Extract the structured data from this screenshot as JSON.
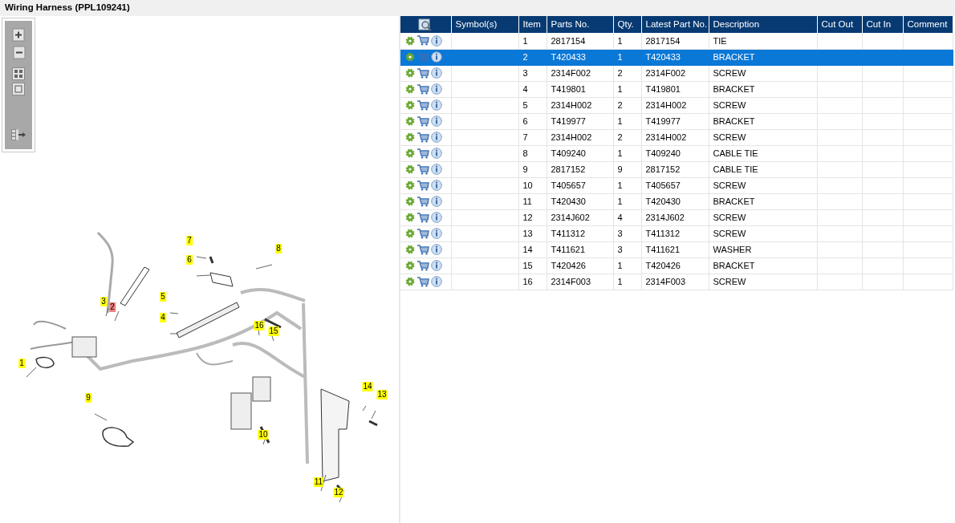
{
  "window": {
    "title": "Wiring Harness (PPL109241)"
  },
  "diagram": {
    "callouts": [
      {
        "label": "1",
        "selected": false
      },
      {
        "label": "2",
        "selected": true
      },
      {
        "label": "3",
        "selected": false
      },
      {
        "label": "4",
        "selected": false
      },
      {
        "label": "5",
        "selected": false
      },
      {
        "label": "6",
        "selected": false
      },
      {
        "label": "7",
        "selected": false
      },
      {
        "label": "8",
        "selected": false
      },
      {
        "label": "9",
        "selected": false
      },
      {
        "label": "10",
        "selected": false
      },
      {
        "label": "11",
        "selected": false
      },
      {
        "label": "12",
        "selected": false
      },
      {
        "label": "13",
        "selected": false
      },
      {
        "label": "14",
        "selected": false
      },
      {
        "label": "15",
        "selected": false
      },
      {
        "label": "16",
        "selected": false
      }
    ]
  },
  "table": {
    "columns": [
      "Symbol(s)",
      "Item",
      "Parts No.",
      "Qty.",
      "Latest Part No.",
      "Description",
      "Cut Out",
      "Cut In",
      "Comment"
    ],
    "rows": [
      {
        "item": "1",
        "parts_no": "2817154",
        "qty": "1",
        "latest_part_no": "2817154",
        "description": "TIE",
        "selected": false
      },
      {
        "item": "2",
        "parts_no": "T420433",
        "qty": "1",
        "latest_part_no": "T420433",
        "description": "BRACKET",
        "selected": true
      },
      {
        "item": "3",
        "parts_no": "2314F002",
        "qty": "2",
        "latest_part_no": "2314F002",
        "description": "SCREW",
        "selected": false
      },
      {
        "item": "4",
        "parts_no": "T419801",
        "qty": "1",
        "latest_part_no": "T419801",
        "description": "BRACKET",
        "selected": false
      },
      {
        "item": "5",
        "parts_no": "2314H002",
        "qty": "2",
        "latest_part_no": "2314H002",
        "description": "SCREW",
        "selected": false
      },
      {
        "item": "6",
        "parts_no": "T419977",
        "qty": "1",
        "latest_part_no": "T419977",
        "description": "BRACKET",
        "selected": false
      },
      {
        "item": "7",
        "parts_no": "2314H002",
        "qty": "2",
        "latest_part_no": "2314H002",
        "description": "SCREW",
        "selected": false
      },
      {
        "item": "8",
        "parts_no": "T409240",
        "qty": "1",
        "latest_part_no": "T409240",
        "description": "CABLE TIE",
        "selected": false
      },
      {
        "item": "9",
        "parts_no": "2817152",
        "qty": "9",
        "latest_part_no": "2817152",
        "description": "CABLE TIE",
        "selected": false
      },
      {
        "item": "10",
        "parts_no": "T405657",
        "qty": "1",
        "latest_part_no": "T405657",
        "description": "SCREW",
        "selected": false
      },
      {
        "item": "11",
        "parts_no": "T420430",
        "qty": "1",
        "latest_part_no": "T420430",
        "description": "BRACKET",
        "selected": false
      },
      {
        "item": "12",
        "parts_no": "2314J602",
        "qty": "4",
        "latest_part_no": "2314J602",
        "description": "SCREW",
        "selected": false
      },
      {
        "item": "13",
        "parts_no": "T411312",
        "qty": "3",
        "latest_part_no": "T411312",
        "description": "SCREW",
        "selected": false
      },
      {
        "item": "14",
        "parts_no": "T411621",
        "qty": "3",
        "latest_part_no": "T411621",
        "description": "WASHER",
        "selected": false
      },
      {
        "item": "15",
        "parts_no": "T420426",
        "qty": "1",
        "latest_part_no": "T420426",
        "description": "BRACKET",
        "selected": false
      },
      {
        "item": "16",
        "parts_no": "2314F003",
        "qty": "1",
        "latest_part_no": "2314F003",
        "description": "SCREW",
        "selected": false
      }
    ]
  }
}
